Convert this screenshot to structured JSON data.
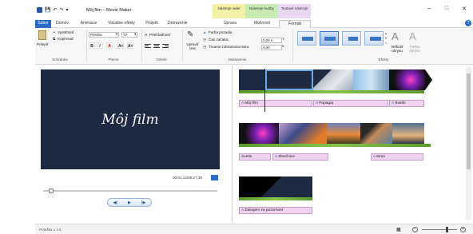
{
  "window": {
    "title": "Môj film – Movie Maker",
    "context_tabs": [
      "Nástroje videí",
      "Nástroje hudby",
      "Textové nástroje"
    ],
    "controls": [
      "–",
      "□",
      "✕"
    ]
  },
  "quick_access": [
    "app-icon",
    "save-icon",
    "undo-icon",
    "redo-icon",
    "customize-icon"
  ],
  "tabs": [
    {
      "label": "Súbor"
    },
    {
      "label": "Domov"
    },
    {
      "label": "Animácie"
    },
    {
      "label": "Vizuálne efekty"
    },
    {
      "label": "Projekt"
    },
    {
      "label": "Zobrazenie"
    },
    {
      "label": "Úprava"
    },
    {
      "label": "Možnosti"
    },
    {
      "label": "Formát"
    }
  ],
  "help": "?",
  "ribbon": {
    "clipboard": {
      "paste": "Prilepiť",
      "cut": "Vystrihnúť",
      "copy": "Kopírovať",
      "group": "Schránka"
    },
    "font": {
      "family": "Pristina",
      "size": "72",
      "bold": "B",
      "italic": "I",
      "color": "A",
      "grow": "A˄",
      "shrink": "A˅",
      "group": "Písmo"
    },
    "paragraph": {
      "transparency": "Priehľadnosť",
      "group": "Odsek"
    },
    "adjust": {
      "edit_text": "Upraviť text",
      "bg_color": "Farba pozadia",
      "start_time_label": "Čas začatia:",
      "start_time": "0,00 s",
      "duration_label": "Trvanie zobrazenia textu:",
      "duration": "4,00",
      "group": "Nastavenie"
    },
    "effects": {
      "group": "Efekty",
      "outline_size": "Veľkosť obrysu",
      "outline_color": "Farba obrysu"
    }
  },
  "preview": {
    "caption": "Môj film",
    "timecode": "00:01,12/00:27,30"
  },
  "storyboard": {
    "row1": [
      "Môj film",
      "Papagaj",
      "Svetlo"
    ],
    "row2": [
      "Svetlo",
      "Slnečnice",
      "More"
    ],
    "row3": [
      "Ďakujem za pozornosť"
    ]
  },
  "status": {
    "items": "Položka 1 z 6"
  },
  "colors": {
    "file_tab": "#2a6cc4",
    "preview_bg": "#1e2a42",
    "caption_bg": "#efd3ef"
  }
}
